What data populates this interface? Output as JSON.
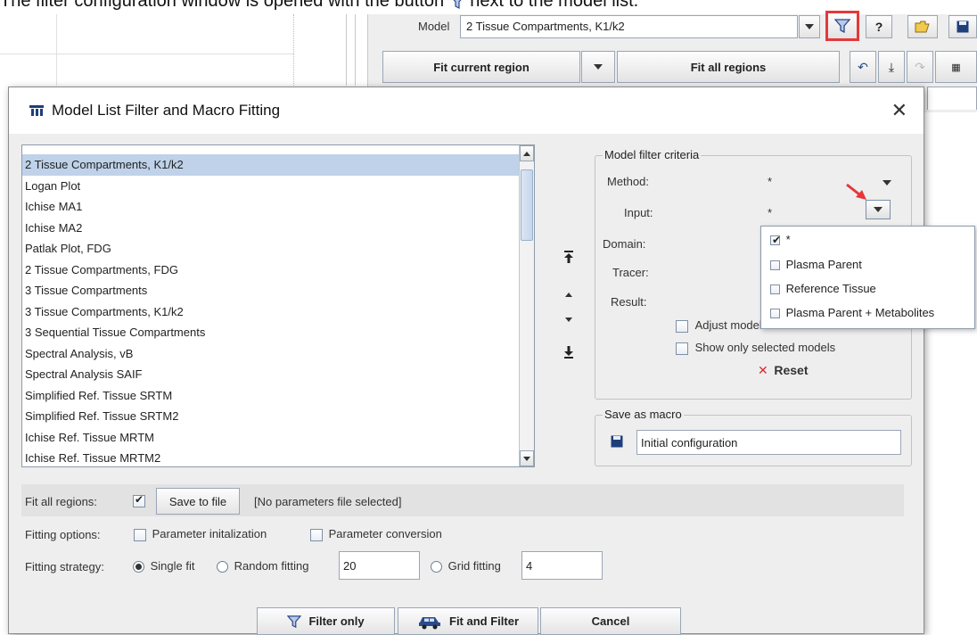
{
  "caption": {
    "text_before": "The filter configuration window is opened with the button",
    "text_after": "next to the model list."
  },
  "background_app": {
    "model_label": "Model",
    "model_value": "2 Tissue Compartments, K1/k2",
    "help_label": "?",
    "fit_current_label": "Fit current region",
    "fit_all_label": "Fit all regions"
  },
  "dialog": {
    "title": "Model List Filter and Macro Fitting",
    "models": [
      "2 Tissue Compartments, K1/k2",
      "Logan Plot",
      "Ichise MA1",
      "Ichise MA2",
      "Patlak Plot, FDG",
      "2 Tissue Compartments, FDG",
      "3 Tissue Compartments",
      "3 Tissue Compartments, K1/k2",
      "3 Sequential Tissue Compartments",
      "Spectral Analysis, vB",
      "Spectral Analysis SAIF",
      "Simplified Ref. Tissue SRTM",
      "Simplified Ref. Tissue SRTM2",
      "Ichise Ref. Tissue MRTM",
      "Ichise Ref. Tissue MRTM2"
    ],
    "filter": {
      "title": "Model filter criteria",
      "method_label": "Method:",
      "method_value": "*",
      "input_label": "Input:",
      "input_value": "*",
      "domain_label": "Domain:",
      "tracer_label": "Tracer:",
      "result_label": "Result:",
      "adjust_label": "Adjust models to filter",
      "show_selected_label": "Show only selected models",
      "reset_label": "Reset"
    },
    "input_popup": {
      "items": [
        {
          "label": "*",
          "checked": true
        },
        {
          "label": "Plasma Parent",
          "checked": false
        },
        {
          "label": "Reference Tissue",
          "checked": false
        },
        {
          "label": "Plasma Parent + Metabolites",
          "checked": false
        }
      ]
    },
    "macro": {
      "title": "Save as macro",
      "name_value": "Initial configuration"
    },
    "fit_all": {
      "label": "Fit all regions:",
      "checked": true,
      "save_button": "Save to file",
      "file_status": "[No parameters file selected]"
    },
    "fitting_options": {
      "label": "Fitting options:",
      "param_init": "Parameter initalization",
      "param_conv": "Parameter conversion"
    },
    "strategy": {
      "label": "Fitting strategy:",
      "single": "Single fit",
      "random": "Random fitting",
      "random_value": "20",
      "grid": "Grid fitting",
      "grid_value": "4"
    },
    "buttons": {
      "filter_only": "Filter only",
      "fit_and_filter": "Fit and Filter",
      "cancel": "Cancel"
    }
  },
  "colors": {
    "selection": "#bfd2e9",
    "highlight_border": "#e5383b",
    "reset_x": "#d32f2f",
    "filter_icon": "#2b4a8a"
  }
}
